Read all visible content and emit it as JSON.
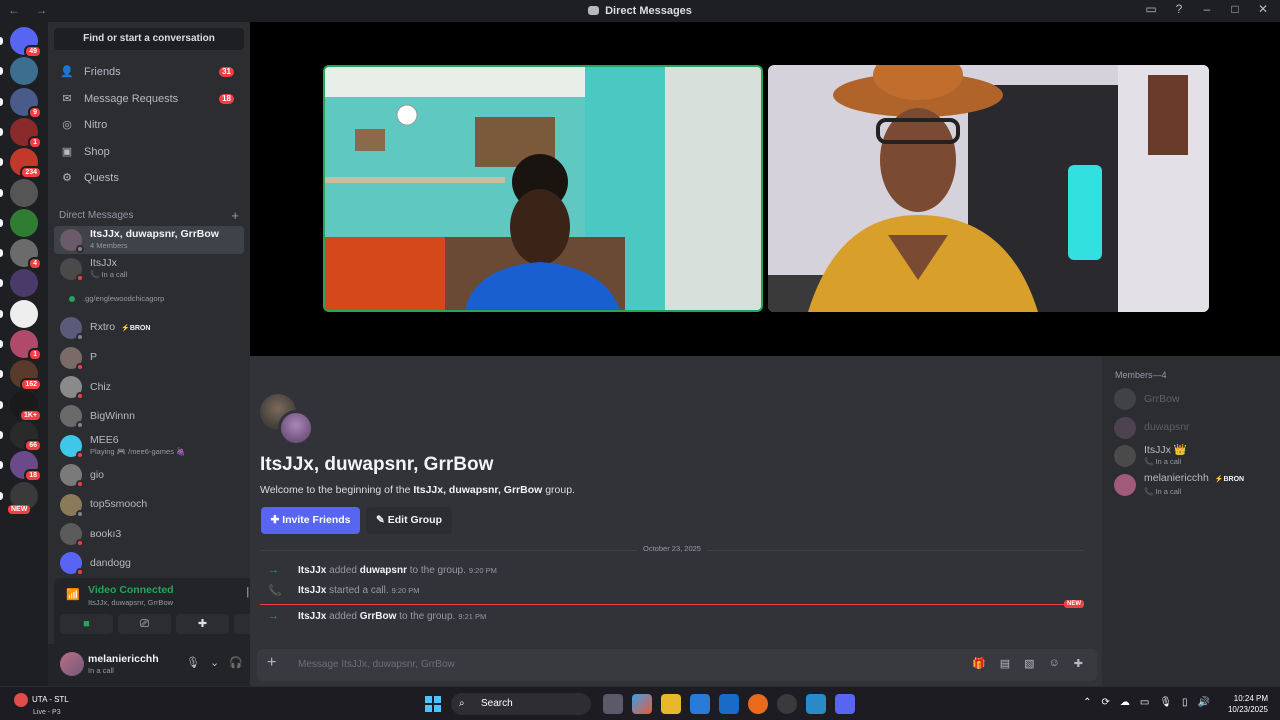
{
  "window": {
    "title": "Direct Messages"
  },
  "servers": [
    {
      "badge": "49",
      "color": "#5865f2"
    },
    {
      "badge": "",
      "color": "#3b6e8f"
    },
    {
      "badge": "9",
      "color": "#4a5a8a"
    },
    {
      "badge": "1",
      "color": "#8a2a2a"
    },
    {
      "badge": "234",
      "color": "#c0392b"
    },
    {
      "badge": "",
      "color": "#555555"
    },
    {
      "badge": "",
      "color": "#2e7d32"
    },
    {
      "badge": "4",
      "color": "#6b6b6b"
    },
    {
      "badge": "",
      "color": "#4a3a6a"
    },
    {
      "badge": "",
      "color": "#eeeeee"
    },
    {
      "badge": "1",
      "color": "#b04a6a"
    },
    {
      "badge": "162",
      "color": "#5a3a2a"
    },
    {
      "badge": "1K+",
      "color": "#1a1a1a"
    },
    {
      "badge": "66",
      "color": "#2a2a2a"
    },
    {
      "badge": "18",
      "color": "#6a4a8a"
    },
    {
      "badge": "NEW",
      "color": "#3a3a3a"
    }
  ],
  "sidebar": {
    "search": "Find or start a conversation",
    "nav": [
      {
        "label": "Friends",
        "count": "31",
        "icon": "friends-icon",
        "glyph": "👤"
      },
      {
        "label": "Message Requests",
        "count": "18",
        "icon": "mail-icon",
        "glyph": "✉"
      },
      {
        "label": "Nitro",
        "count": "",
        "icon": "nitro-icon",
        "glyph": "◎"
      },
      {
        "label": "Shop",
        "count": "",
        "icon": "shop-icon",
        "glyph": "▣"
      },
      {
        "label": "Quests",
        "count": "",
        "icon": "quests-icon",
        "glyph": "⚙"
      }
    ],
    "dm_header": "Direct Messages",
    "dms": [
      {
        "name": "ItsJJx, duwapsnr, GrrBow",
        "sub": "4 Members",
        "selected": true,
        "color": "#6a5a6a"
      },
      {
        "name": "ItsJJx",
        "sub": "📞 In a call",
        "color": "#4a4a4a"
      },
      {
        "name": "",
        "sub": ".gg/englewoodchicagorp",
        "color": ""
      },
      {
        "name": "Rxtro",
        "sub": "",
        "tag": "BRON",
        "color": "#5a5a7a"
      },
      {
        "name": "P",
        "sub": "",
        "color": "#7a6a6a"
      },
      {
        "name": "Chiz",
        "sub": "",
        "color": "#8a8a8a"
      },
      {
        "name": "BigWinnn",
        "sub": "",
        "color": "#6a6a6a"
      },
      {
        "name": "MEE6",
        "sub": "Playing 🎮 /mee6-games 🍇",
        "color": "#3ec7e8"
      },
      {
        "name": "gio",
        "sub": "",
        "color": "#7a7a7a"
      },
      {
        "name": "top5smooch",
        "sub": "",
        "color": "#8a7a5a"
      },
      {
        "name": "вookı3",
        "sub": "",
        "color": "#5a5a5a"
      },
      {
        "name": "dandogg",
        "sub": "",
        "color": "#5865f2"
      }
    ]
  },
  "voice": {
    "status": "Video Connected",
    "channel": "ItsJJx, duwapsnr, GrrBow"
  },
  "user": {
    "name": "melaniericchh",
    "status": "In a call"
  },
  "call": {},
  "group": {
    "title": "ItsJJx, duwapsnr, GrrBow",
    "welcome_pre": "Welcome to the beginning of the ",
    "welcome_name": "ItsJJx, duwapsnr, GrrBow",
    "welcome_post": " group.",
    "invite": "Invite Friends",
    "edit": "Edit Group"
  },
  "date": "October 23, 2025",
  "messages": [
    {
      "icon": "→",
      "actor": "ItsJJx",
      "mid": " added ",
      "target": "duwapsnr",
      "end": " to the group.",
      "time": "9:20 PM"
    },
    {
      "icon": "📞",
      "actor": "ItsJJx",
      "mid": " started a call.",
      "target": "",
      "end": "",
      "time": "9:20 PM"
    },
    {
      "icon": "→",
      "actor": "ItsJJx",
      "mid": " added ",
      "target": "GrrBow",
      "end": " to the group.",
      "time": "9:21 PM"
    }
  ],
  "new_label": "NEW",
  "composer": {
    "placeholder": "Message ItsJJx, duwapsnr, GrrBow"
  },
  "members": {
    "header": "Members—4",
    "list": [
      {
        "name": "GrrBow",
        "sub": "",
        "dim": true,
        "color": "#6a6a6a"
      },
      {
        "name": "duwapsnr",
        "sub": "",
        "dim": true,
        "color": "#8a6a8a"
      },
      {
        "name": "ItsJJx 👑",
        "sub": "📞 In a call",
        "dim": false,
        "color": "#4a4a4a"
      },
      {
        "name": "melaniericchh",
        "sub": "📞 In a call",
        "dim": false,
        "tag": "BRON",
        "color": "#a05a7a"
      }
    ]
  },
  "taskbar": {
    "weather_title": "UTA - STL",
    "weather_sub": "Live - P3",
    "search": "Search",
    "time": "10:24 PM",
    "date": "10/23/2025"
  }
}
